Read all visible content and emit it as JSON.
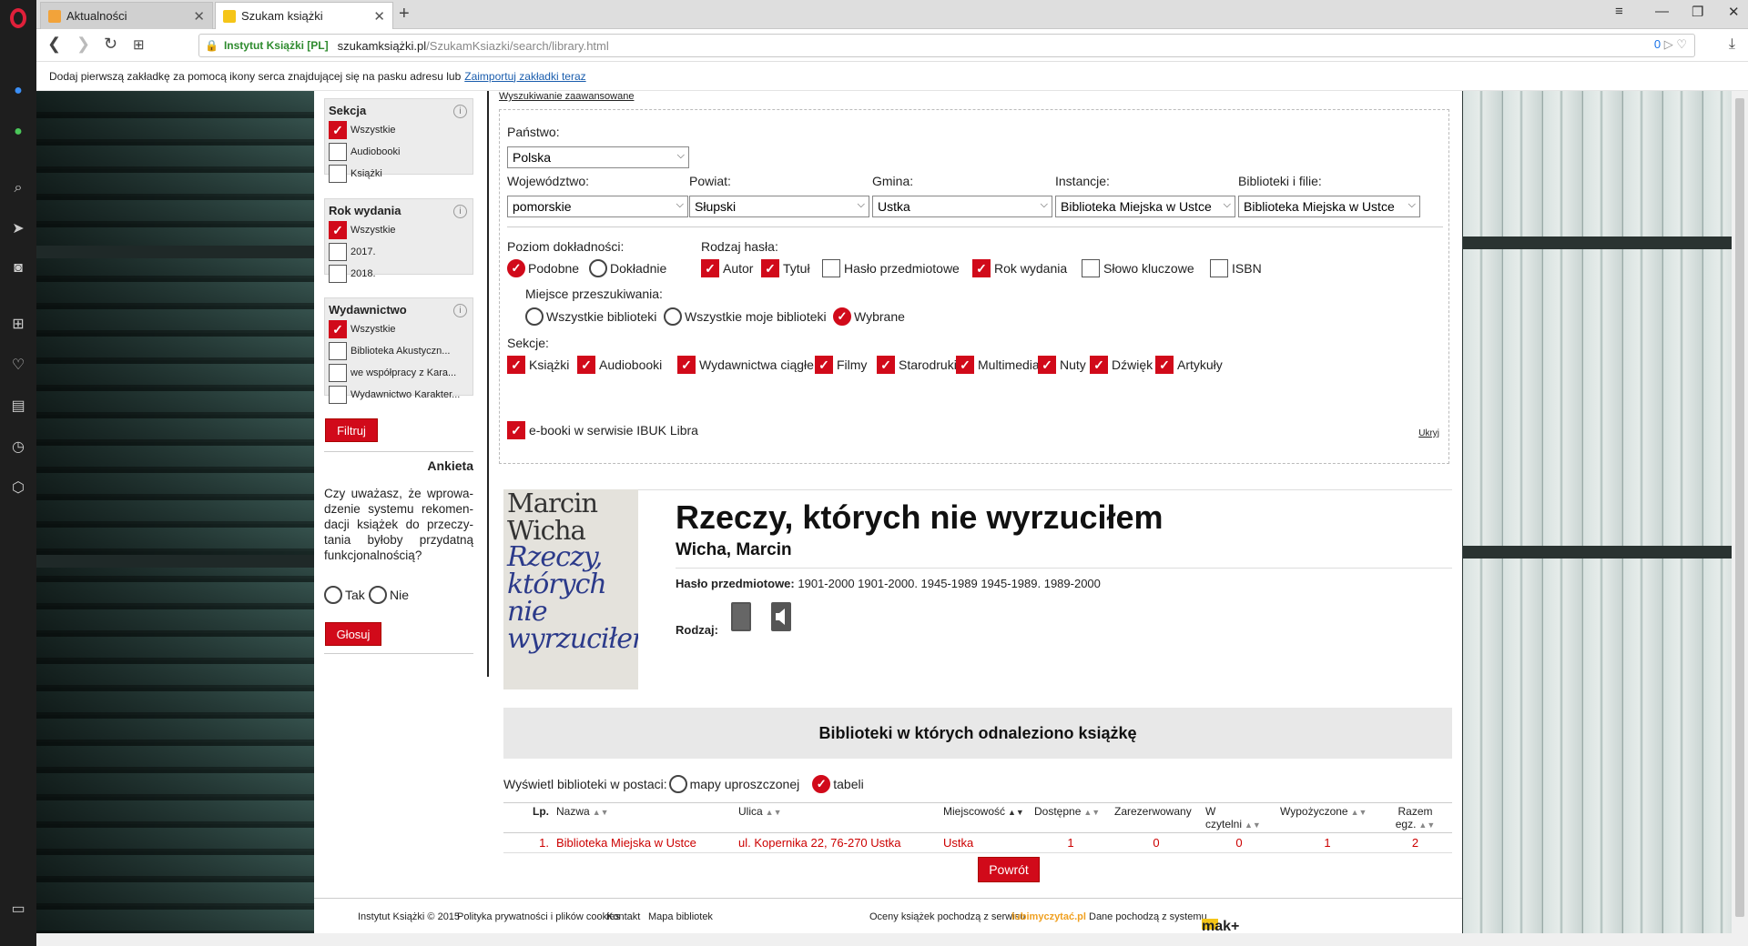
{
  "browser": {
    "tabs": [
      {
        "label": "Aktualności",
        "active": false
      },
      {
        "label": "Szukam książki",
        "active": true
      }
    ],
    "url": {
      "cert": "Instytut Książki [PL]",
      "domain": "szukamksiążki.pl",
      "path": "/SzukamKsiazki/search/library.html",
      "badge": "0"
    },
    "bookmark_bar": {
      "text": "Dodaj pierwszą zakładkę za pomocą ikony serca znajdującej się na pasku adresu lub",
      "link": "Zaimportuj zakładki teraz"
    }
  },
  "facets": [
    {
      "title": "Sekcja",
      "items": [
        {
          "label": "Wszystkie",
          "checked": true
        },
        {
          "label": "Audiobooki",
          "checked": false
        },
        {
          "label": "Książki",
          "checked": false
        }
      ]
    },
    {
      "title": "Rok wydania",
      "items": [
        {
          "label": "Wszystkie",
          "checked": true
        },
        {
          "label": "2017.",
          "checked": false
        },
        {
          "label": "2018.",
          "checked": false
        }
      ]
    },
    {
      "title": "Wydawnictwo",
      "items": [
        {
          "label": "Wszystkie",
          "checked": true
        },
        {
          "label": "Biblioteka Akustyczn...",
          "checked": false
        },
        {
          "label": "we współpracy z Kara...",
          "checked": false
        },
        {
          "label": "Wydawnictwo Karakter...",
          "checked": false
        }
      ]
    }
  ],
  "filter_button": "Filtruj",
  "poll": {
    "title": "Ankieta",
    "question": "Czy uważasz, że wprowa-dzenie systemu rekomen-dacji książek do przeczy-tania byłoby przydatną funkcjonalnością?",
    "options": [
      "Tak",
      "Nie"
    ],
    "vote_button": "Głosuj"
  },
  "search": {
    "advanced_link": "Wyszukiwanie zaawansowane",
    "country_label": "Państwo:",
    "country_value": "Polska",
    "voivodeship_label": "Województwo:",
    "voivodeship_value": "pomorskie",
    "county_label": "Powiat:",
    "county_value": "Słupski",
    "commune_label": "Gmina:",
    "commune_value": "Ustka",
    "instances_label": "Instancje:",
    "instances_value": "Biblioteka Miejska w Ustce",
    "libraries_label": "Biblioteki i filie:",
    "libraries_value": "Biblioteka Miejska w Ustce",
    "accuracy_label": "Poziom dokładności:",
    "accuracy_options": [
      {
        "label": "Podobne",
        "checked": true
      },
      {
        "label": "Dokładnie",
        "checked": false
      }
    ],
    "term_type_label": "Rodzaj hasła:",
    "term_types": [
      {
        "label": "Autor",
        "checked": true
      },
      {
        "label": "Tytuł",
        "checked": true
      },
      {
        "label": "Hasło przedmiotowe",
        "checked": false
      },
      {
        "label": "Rok wydania",
        "checked": true
      },
      {
        "label": "Słowo kluczowe",
        "checked": false
      },
      {
        "label": "ISBN",
        "checked": false
      }
    ],
    "place_label": "Miejsce przeszukiwania:",
    "places": [
      {
        "label": "Wszystkie biblioteki",
        "checked": false
      },
      {
        "label": "Wszystkie moje biblioteki",
        "checked": false
      },
      {
        "label": "Wybrane",
        "checked": true
      }
    ],
    "sections_label": "Sekcje:",
    "sections": [
      {
        "label": "Książki",
        "checked": true
      },
      {
        "label": "Audiobooki",
        "checked": true
      },
      {
        "label": "Wydawnictwa ciągłe",
        "checked": true
      },
      {
        "label": "Filmy",
        "checked": true
      },
      {
        "label": "Starodruki",
        "checked": true
      },
      {
        "label": "Multimedia",
        "checked": true
      },
      {
        "label": "Nuty",
        "checked": true
      },
      {
        "label": "Dźwięk",
        "checked": true
      },
      {
        "label": "Artykuły",
        "checked": true
      }
    ],
    "ebook_label": "e-booki w serwisie IBUK Libra",
    "ebook_checked": true,
    "hide_link": "Ukryj"
  },
  "book": {
    "cover_author": "Marcin Wicha",
    "cover_title": "Rzeczy, których nie wyrzuciłem",
    "title": "Rzeczy, których nie wyrzuciłem",
    "author": "Wicha, Marcin",
    "subject_label": "Hasło przedmiotowe:",
    "subject_value": "1901-2000 1901-2000. 1945-1989 1945-1989. 1989-2000",
    "type_label": "Rodzaj:"
  },
  "libraries": {
    "header": "Biblioteki w których odnaleziono książkę",
    "display_label": "Wyświetl biblioteki w postaci:",
    "display_options": [
      {
        "label": "mapy uproszczonej",
        "checked": false
      },
      {
        "label": "tabeli",
        "checked": true
      }
    ],
    "columns": [
      "Lp.",
      "Nazwa",
      "Ulica",
      "Miejscowość",
      "Dostępne",
      "Zarezerwowany",
      "W czytelni",
      "Wypożyczone",
      "Razem egz."
    ],
    "rows": [
      [
        "1.",
        "Biblioteka Miejska w Ustce",
        "ul. Kopernika 22, 76-270 Ustka",
        "Ustka",
        "1",
        "0",
        "0",
        "1",
        "2"
      ]
    ],
    "back_button": "Powrót"
  },
  "footer": {
    "copyright": "Instytut Książki © 2015",
    "privacy": "Polityka prywatności i plików cookies",
    "contact": "Kontakt",
    "map": "Mapa bibliotek",
    "ratings": "Oceny książek pochodzą z serwisu",
    "ratings_brand": "lubimyczytać.pl",
    "data_source": "Dane pochodzą z systemu",
    "data_brand": "mak+"
  },
  "colors": {
    "accent": "#d10a1a",
    "link": "#1a5dad"
  },
  "icons": [
    "opera-logo",
    "messenger-icon",
    "whatsapp-icon",
    "search-icon",
    "send-icon",
    "camera-icon",
    "speed-dial-icon",
    "heart-icon",
    "news-icon",
    "history-icon",
    "extensions-icon",
    "sidebar-toggle-icon",
    "book-icon",
    "audiobook-icon"
  ]
}
